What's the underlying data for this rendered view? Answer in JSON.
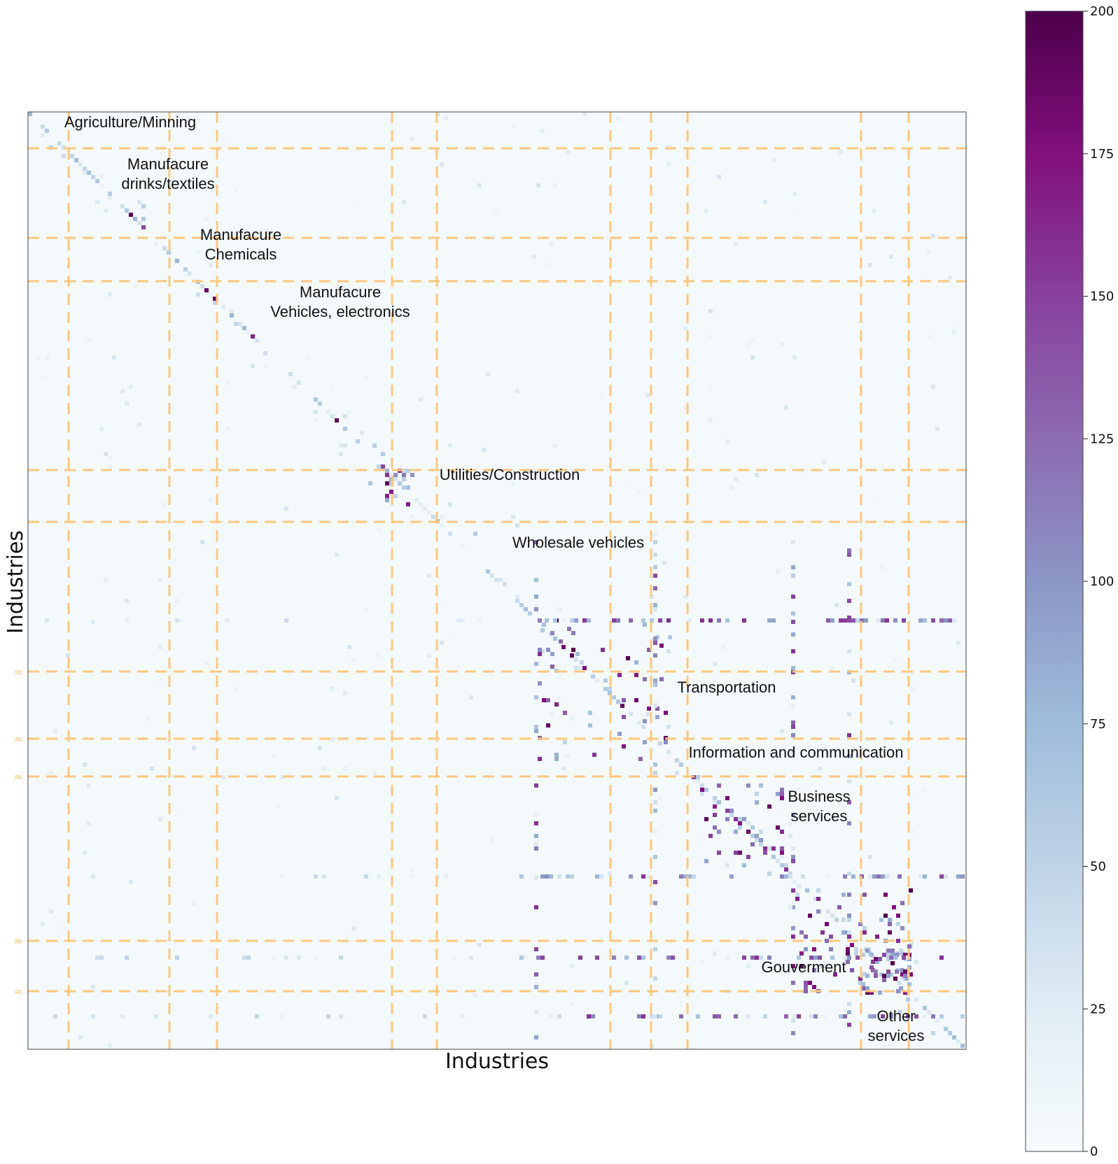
{
  "chart_data": {
    "type": "heatmap",
    "title": "",
    "xlabel": "Industries",
    "ylabel": "Industries",
    "colorbar": {
      "range": [
        0,
        200
      ],
      "ticks": [
        0,
        25,
        50,
        75,
        100,
        125,
        150,
        175,
        200
      ],
      "colormap": "BuPu",
      "stops": [
        "#f7fcfd",
        "#e0ecf4",
        "#bfd3e6",
        "#9ebcda",
        "#8c96c6",
        "#8c6bb1",
        "#88419d",
        "#810f7c",
        "#4d004b"
      ]
    },
    "grid": false,
    "separator_color": "#fdc77c",
    "separator_style": "dashed",
    "sections": [
      {
        "label": [
          "Agriculture/Minning"
        ]
      },
      {
        "label": [
          "Manufacure",
          "drinks/textiles"
        ]
      },
      {
        "label": [
          "Manufacure",
          "Chemicals"
        ]
      },
      {
        "label": [
          "Manufacure",
          "Vehicles, electronics"
        ]
      },
      {
        "label": [
          "Utilities/Construction"
        ]
      },
      {
        "label": [
          "Wholesale vehicles"
        ]
      },
      {
        "label": [
          "Transportation"
        ]
      },
      {
        "label": [
          "Information and communication"
        ]
      },
      {
        "label": [
          "Business",
          "services"
        ]
      },
      {
        "label": [
          "Gouverment"
        ]
      },
      {
        "label": [
          "Other",
          "services"
        ]
      }
    ],
    "break_marker": "≈",
    "break_marker_count": 5,
    "notes": "Cell-level matrix values are not legible; matrix is mostly near 0 with dense high-value blocks in the service-sector rows/columns (up to ~200)."
  }
}
